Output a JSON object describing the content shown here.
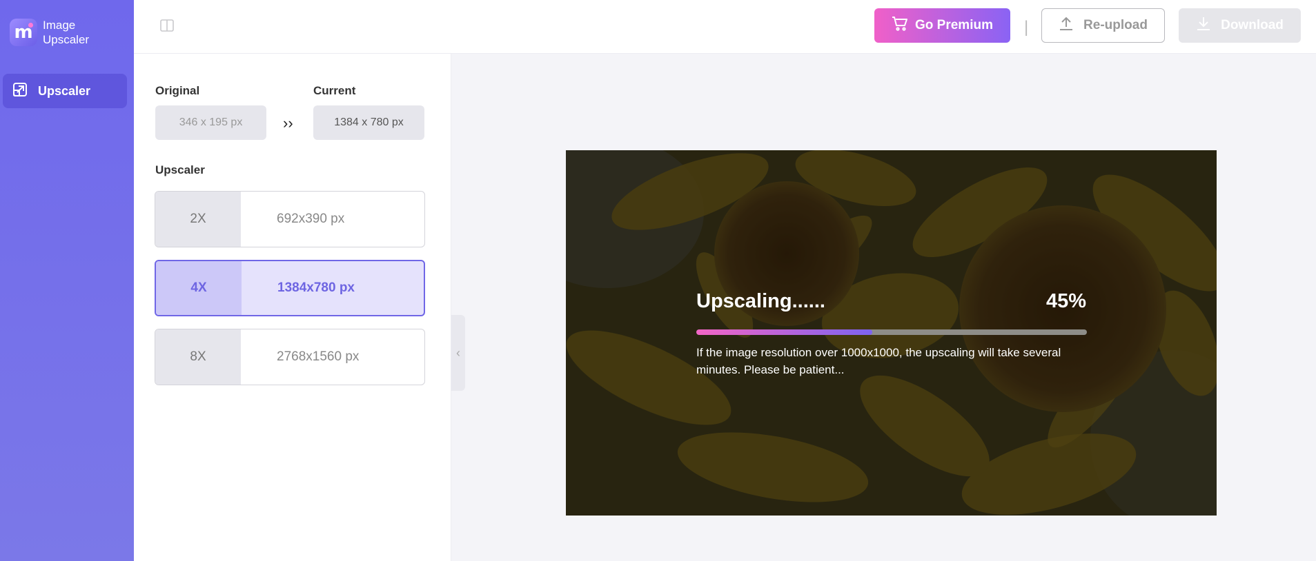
{
  "app": {
    "brand_line1": "Image",
    "brand_line2": "Upscaler",
    "brand_glyph": "m"
  },
  "sidebar": {
    "items": [
      {
        "label": "Upscaler",
        "icon": "upscale-icon",
        "active": true
      }
    ]
  },
  "toolbar": {
    "premium_label": "Go Premium",
    "separator": "|",
    "reupload_label": "Re-upload",
    "download_label": "Download",
    "download_enabled": false
  },
  "settings": {
    "original_label": "Original",
    "original_value": "346 x 195 px",
    "current_label": "Current",
    "current_value": "1384 x 780 px",
    "arrows": "››",
    "upscaler_label": "Upscaler",
    "options": [
      {
        "multiplier": "2X",
        "dimensions": "692x390 px",
        "selected": false
      },
      {
        "multiplier": "4X",
        "dimensions": "1384x780 px",
        "selected": true
      },
      {
        "multiplier": "8X",
        "dimensions": "2768x1560 px",
        "selected": false
      }
    ]
  },
  "status": {
    "title": "Upscaling......",
    "percent_text": "45%",
    "progress": 0.45,
    "note": "If the image resolution over 1000x1000, the upscaling will take several minutes. Please be patient..."
  },
  "colors": {
    "accent": "#6f66e6",
    "premium_start": "#f060c8",
    "premium_end": "#8a63f4",
    "sidebar": "#6f68ec"
  }
}
